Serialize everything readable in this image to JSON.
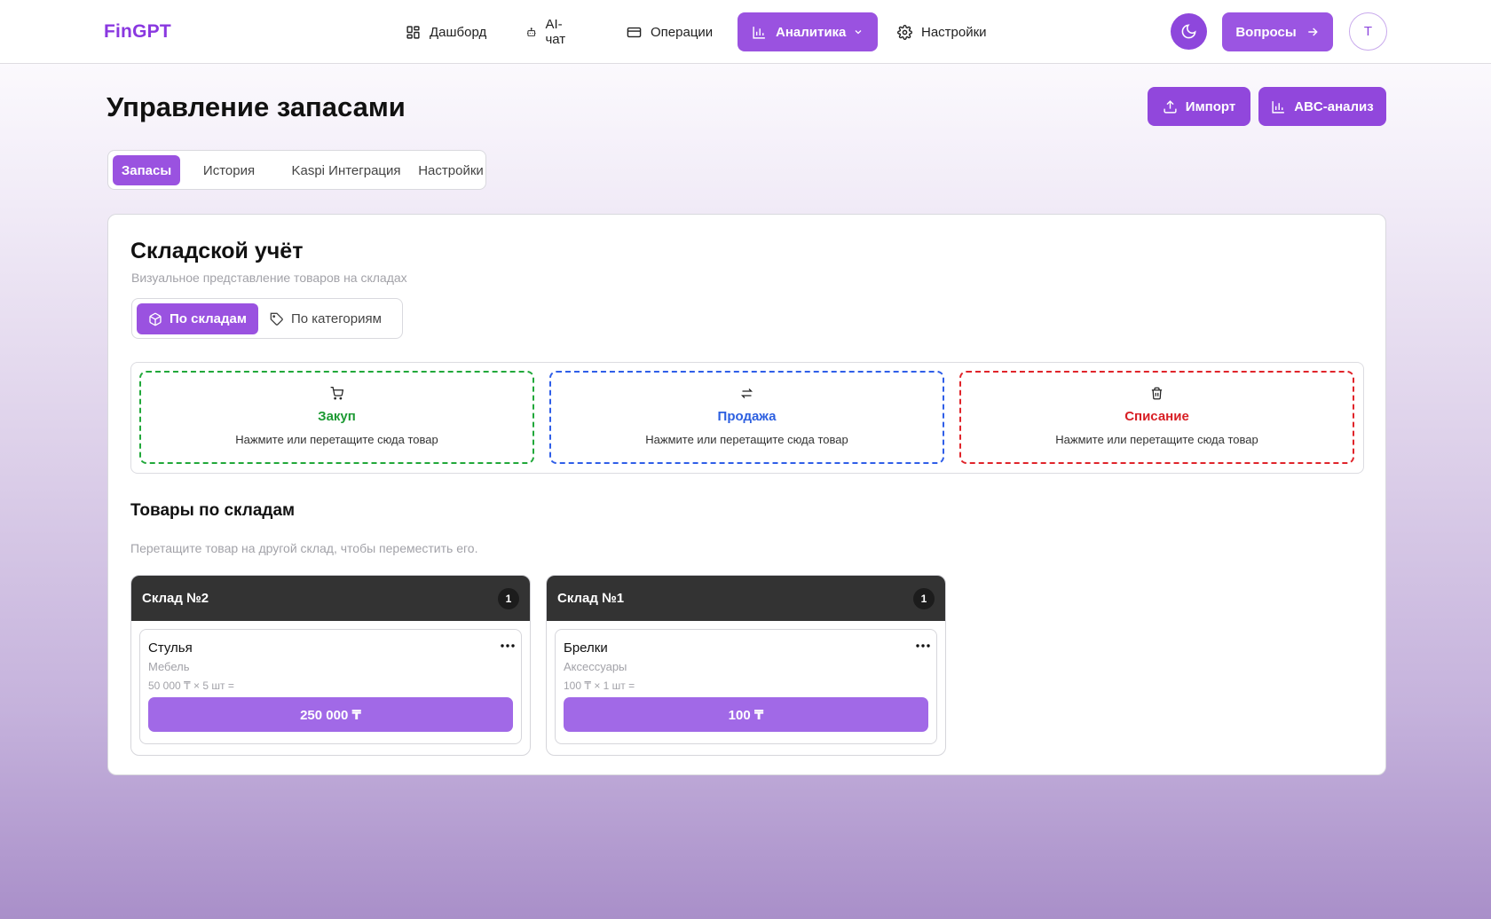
{
  "app": {
    "brand": "FinGPT"
  },
  "nav": {
    "items": [
      {
        "label": "Дашборд",
        "icon": "dashboard-grid-icon"
      },
      {
        "label": "AI-чат",
        "icon": "bot-icon"
      },
      {
        "label": "Операции",
        "icon": "credit-card-icon"
      },
      {
        "label": "Аналитика",
        "icon": "bar-chart-icon",
        "active": true
      },
      {
        "label": "Настройки",
        "icon": "gear-icon"
      }
    ],
    "questions_label": "Вопросы",
    "avatar_initial": "T"
  },
  "page": {
    "title": "Управление запасами",
    "import_label": "Импорт",
    "abc_label": "ABC-анализ"
  },
  "tabs": [
    {
      "label": "Запасы",
      "active": true
    },
    {
      "label": "История"
    },
    {
      "label": "Kaspi Интеграция"
    },
    {
      "label": "Настройки"
    }
  ],
  "inventory": {
    "title": "Складской учёт",
    "subtitle": "Визуальное представление товаров на складах",
    "view_toggle": {
      "by_warehouse": "По складам",
      "by_category": "По категориям",
      "selected": "По складам"
    },
    "zones": [
      {
        "title": "Закуп",
        "desc": "Нажмите или перетащите сюда товар",
        "color": "#21a83a",
        "icon": "cart-icon"
      },
      {
        "title": "Продажа",
        "desc": "Нажмите или перетащите сюда товар",
        "color": "#2f5ee8",
        "icon": "swap-arrows-icon"
      },
      {
        "title": "Списание",
        "desc": "Нажмите или перетащите сюда товар",
        "color": "#e0242a",
        "icon": "trash-icon"
      }
    ],
    "section_title": "Товары по складам",
    "section_hint": "Перетащите товар на другой склад, чтобы переместить его.",
    "warehouses": [
      {
        "name": "Склад №2",
        "count": "1",
        "items": [
          {
            "name": "Стулья",
            "category": "Мебель",
            "calc": "50 000 ₸ × 5 шт =",
            "total": "250 000 ₸"
          }
        ]
      },
      {
        "name": "Склад №1",
        "count": "1",
        "items": [
          {
            "name": "Брелки",
            "category": "Аксессуары",
            "calc": "100 ₸ × 1 шт =",
            "total": "100 ₸"
          }
        ]
      }
    ]
  },
  "colors": {
    "accent": "#9a52e0",
    "warehouse_header": "#333333"
  }
}
